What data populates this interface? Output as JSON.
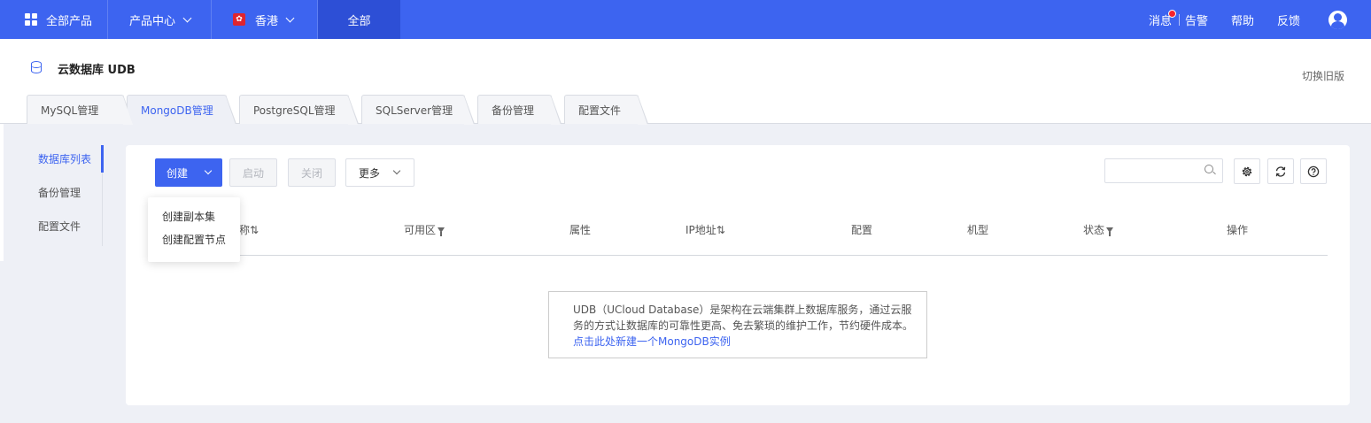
{
  "topbar": {
    "all_products": "全部产品",
    "product_center": "产品中心",
    "region": "香港",
    "scope": "全部",
    "messages": "消息",
    "alerts": "告警",
    "help": "帮助",
    "feedback": "反馈"
  },
  "header": {
    "title": "云数据库 UDB",
    "switch_old": "切换旧版"
  },
  "tabs": [
    {
      "label": "MySQL管理"
    },
    {
      "label": "MongoDB管理"
    },
    {
      "label": "PostgreSQL管理"
    },
    {
      "label": "SQLServer管理"
    },
    {
      "label": "备份管理"
    },
    {
      "label": "配置文件"
    }
  ],
  "subnav": [
    {
      "label": "数据库列表"
    },
    {
      "label": "备份管理"
    },
    {
      "label": "配置文件"
    }
  ],
  "toolbar": {
    "create": "创建",
    "start": "启动",
    "stop": "关闭",
    "more": "更多"
  },
  "dropdown": [
    {
      "label": "创建副本集"
    },
    {
      "label": "创建配置节点"
    }
  ],
  "table": {
    "columns": [
      "称⇅",
      "可用区",
      "属性",
      "IP地址⇅",
      "配置",
      "机型",
      "状态",
      "操作"
    ]
  },
  "empty": {
    "line1": "UDB（UCloud Database）是架构在云端集群上数据库服务，通过云服",
    "line2": "务的方式让数据库的可靠性更高、免去繁琐的维护工作，节约硬件成本。",
    "link": "点击此处新建一个MongoDB实例"
  },
  "colors": {
    "brand": "#3d64f0",
    "notification_dot": "#f5222d",
    "region_flag": "#e0242e"
  }
}
